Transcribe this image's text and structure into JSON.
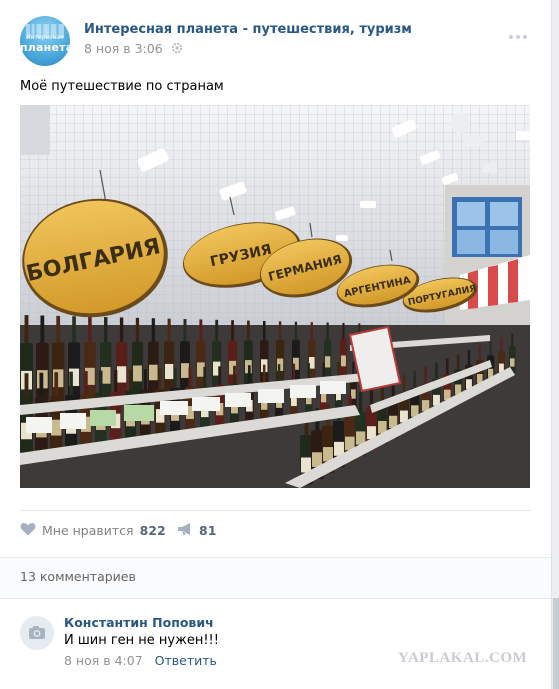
{
  "post": {
    "group_name": "Интересная планета - путешествия, туризм",
    "date": "8 ноя в 3:06",
    "text": "Моё путешествие по странам",
    "avatar_text_small": "Интересная",
    "avatar_text_big": "планета"
  },
  "photo": {
    "signs": [
      "БОЛГАРИЯ",
      "ГРУЗИЯ",
      "ГЕРМАНИЯ",
      "АРГЕНТИНА",
      "ПОРТУГАЛИЯ"
    ]
  },
  "actions": {
    "like_label": "Мне нравится",
    "like_count": "822",
    "share_count": "81"
  },
  "comments": {
    "count_label": "13 комментариев",
    "items": [
      {
        "author": "Константин Попович",
        "text": "И шин ген не нужен!!!",
        "date": "8 ноя в 4:07",
        "reply_label": "Ответить"
      }
    ]
  },
  "watermark": "YAPLAKAL.COM",
  "colors": {
    "link": "#2a5885",
    "muted": "#939393",
    "sign_fill": "#e3ae3a",
    "sign_text": "#3b2e16"
  }
}
